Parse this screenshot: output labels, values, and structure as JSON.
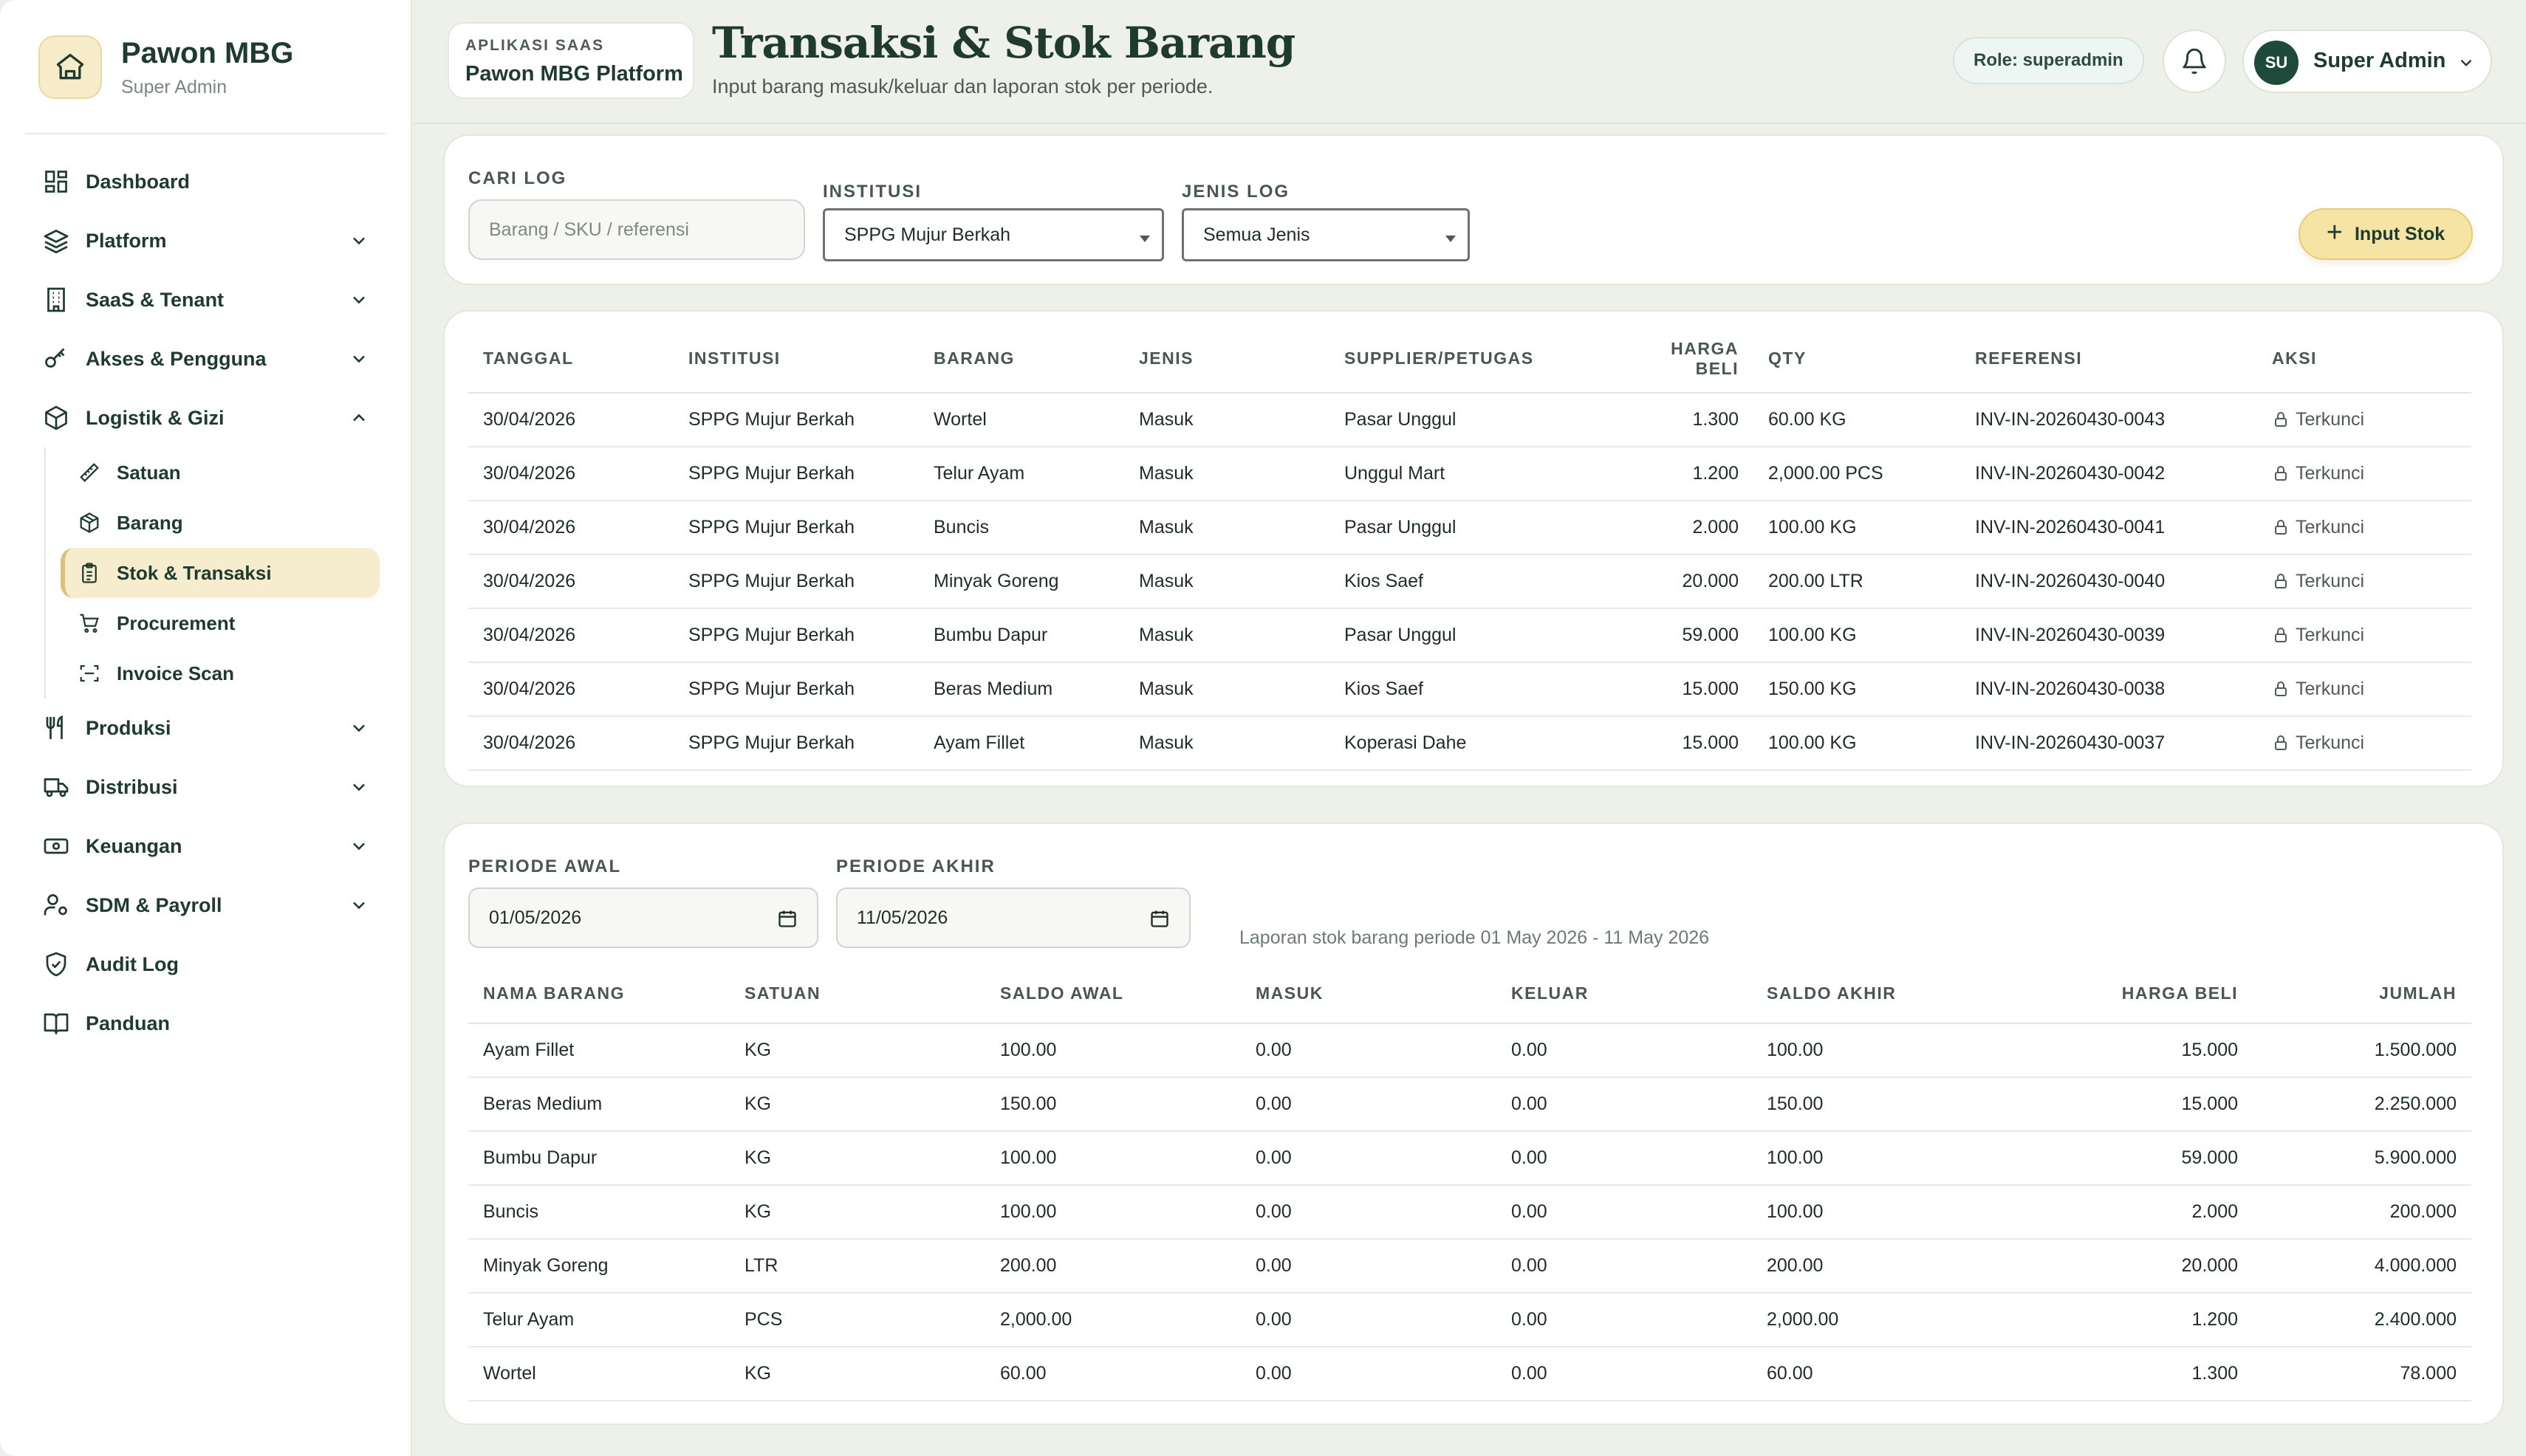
{
  "brand": {
    "name": "Pawon MBG",
    "subtitle": "Super Admin",
    "logo_icon": "chef-hat-icon"
  },
  "sidebar": {
    "items": [
      {
        "label": "Dashboard",
        "icon": "dashboard-icon"
      },
      {
        "label": "Platform",
        "icon": "layers-icon"
      },
      {
        "label": "SaaS & Tenant",
        "icon": "building-icon"
      },
      {
        "label": "Akses & Pengguna",
        "icon": "key-icon"
      },
      {
        "label": "Logistik & Gizi",
        "icon": "box-icon",
        "expanded": true
      },
      {
        "label": "Produksi",
        "icon": "utensils-icon"
      },
      {
        "label": "Distribusi",
        "icon": "truck-icon"
      },
      {
        "label": "Keuangan",
        "icon": "cash-icon"
      },
      {
        "label": "SDM & Payroll",
        "icon": "user-gear-icon"
      },
      {
        "label": "Audit Log",
        "icon": "shield-check-icon"
      },
      {
        "label": "Panduan",
        "icon": "book-icon"
      }
    ],
    "logistik_sub": [
      {
        "label": "Satuan",
        "icon": "ruler-icon"
      },
      {
        "label": "Barang",
        "icon": "package-icon"
      },
      {
        "label": "Stok & Transaksi",
        "icon": "clipboard-icon",
        "active": true
      },
      {
        "label": "Procurement",
        "icon": "cart-icon"
      },
      {
        "label": "Invoice Scan",
        "icon": "scan-icon"
      }
    ]
  },
  "header": {
    "app_kicker": "APLIKASI SAAS",
    "app_name": "Pawon MBG Platform",
    "title": "Transaksi & Stok Barang",
    "subtitle": "Input barang masuk/keluar dan laporan stok per periode.",
    "role": "Role: superadmin",
    "user_initials": "SU",
    "user_name": "Super Admin"
  },
  "filters": {
    "search_label": "CARI LOG",
    "search_placeholder": "Barang / SKU / referensi",
    "institusi_label": "INSTITUSI",
    "institusi_value": "SPPG Mujur Berkah",
    "jenis_label": "JENIS LOG",
    "jenis_value": "Semua Jenis",
    "input_button": "Input Stok"
  },
  "log_table": {
    "headers": [
      "TANGGAL",
      "INSTITUSI",
      "BARANG",
      "JENIS",
      "SUPPLIER/PETUGAS",
      "HARGA BELI",
      "QTY",
      "REFERENSI",
      "AKSI"
    ],
    "rows": [
      [
        "30/04/2026",
        "SPPG Mujur Berkah",
        "Wortel",
        "Masuk",
        "Pasar Unggul",
        "1.300",
        "60.00 KG",
        "INV-IN-20260430-0043",
        "Terkunci"
      ],
      [
        "30/04/2026",
        "SPPG Mujur Berkah",
        "Telur Ayam",
        "Masuk",
        "Unggul Mart",
        "1.200",
        "2,000.00 PCS",
        "INV-IN-20260430-0042",
        "Terkunci"
      ],
      [
        "30/04/2026",
        "SPPG Mujur Berkah",
        "Buncis",
        "Masuk",
        "Pasar Unggul",
        "2.000",
        "100.00 KG",
        "INV-IN-20260430-0041",
        "Terkunci"
      ],
      [
        "30/04/2026",
        "SPPG Mujur Berkah",
        "Minyak Goreng",
        "Masuk",
        "Kios Saef",
        "20.000",
        "200.00 LTR",
        "INV-IN-20260430-0040",
        "Terkunci"
      ],
      [
        "30/04/2026",
        "SPPG Mujur Berkah",
        "Bumbu Dapur",
        "Masuk",
        "Pasar Unggul",
        "59.000",
        "100.00 KG",
        "INV-IN-20260430-0039",
        "Terkunci"
      ],
      [
        "30/04/2026",
        "SPPG Mujur Berkah",
        "Beras Medium",
        "Masuk",
        "Kios Saef",
        "15.000",
        "150.00 KG",
        "INV-IN-20260430-0038",
        "Terkunci"
      ],
      [
        "30/04/2026",
        "SPPG Mujur Berkah",
        "Ayam Fillet",
        "Masuk",
        "Koperasi Dahe",
        "15.000",
        "100.00 KG",
        "INV-IN-20260430-0037",
        "Terkunci"
      ]
    ]
  },
  "report": {
    "start_label": "PERIODE AWAL",
    "start_value": "01/05/2026",
    "end_label": "PERIODE AKHIR",
    "end_value": "11/05/2026",
    "note": "Laporan stok barang periode 01 May 2026 - 11 May 2026",
    "headers": [
      "NAMA BARANG",
      "SATUAN",
      "SALDO AWAL",
      "MASUK",
      "KELUAR",
      "SALDO AKHIR",
      "HARGA BELI",
      "JUMLAH"
    ],
    "rows": [
      [
        "Ayam Fillet",
        "KG",
        "100.00",
        "0.00",
        "0.00",
        "100.00",
        "15.000",
        "1.500.000"
      ],
      [
        "Beras Medium",
        "KG",
        "150.00",
        "0.00",
        "0.00",
        "150.00",
        "15.000",
        "2.250.000"
      ],
      [
        "Bumbu Dapur",
        "KG",
        "100.00",
        "0.00",
        "0.00",
        "100.00",
        "59.000",
        "5.900.000"
      ],
      [
        "Buncis",
        "KG",
        "100.00",
        "0.00",
        "0.00",
        "100.00",
        "2.000",
        "200.000"
      ],
      [
        "Minyak Goreng",
        "LTR",
        "200.00",
        "0.00",
        "0.00",
        "200.00",
        "20.000",
        "4.000.000"
      ],
      [
        "Telur Ayam",
        "PCS",
        "2,000.00",
        "0.00",
        "0.00",
        "2,000.00",
        "1.200",
        "2.400.000"
      ],
      [
        "Wortel",
        "KG",
        "60.00",
        "0.00",
        "0.00",
        "60.00",
        "1.300",
        "78.000"
      ]
    ]
  },
  "colors": {
    "accent": "#1f3b2f",
    "highlight": "#f6edcf",
    "button": "#f5e4a4",
    "background": "#edf1ea"
  }
}
